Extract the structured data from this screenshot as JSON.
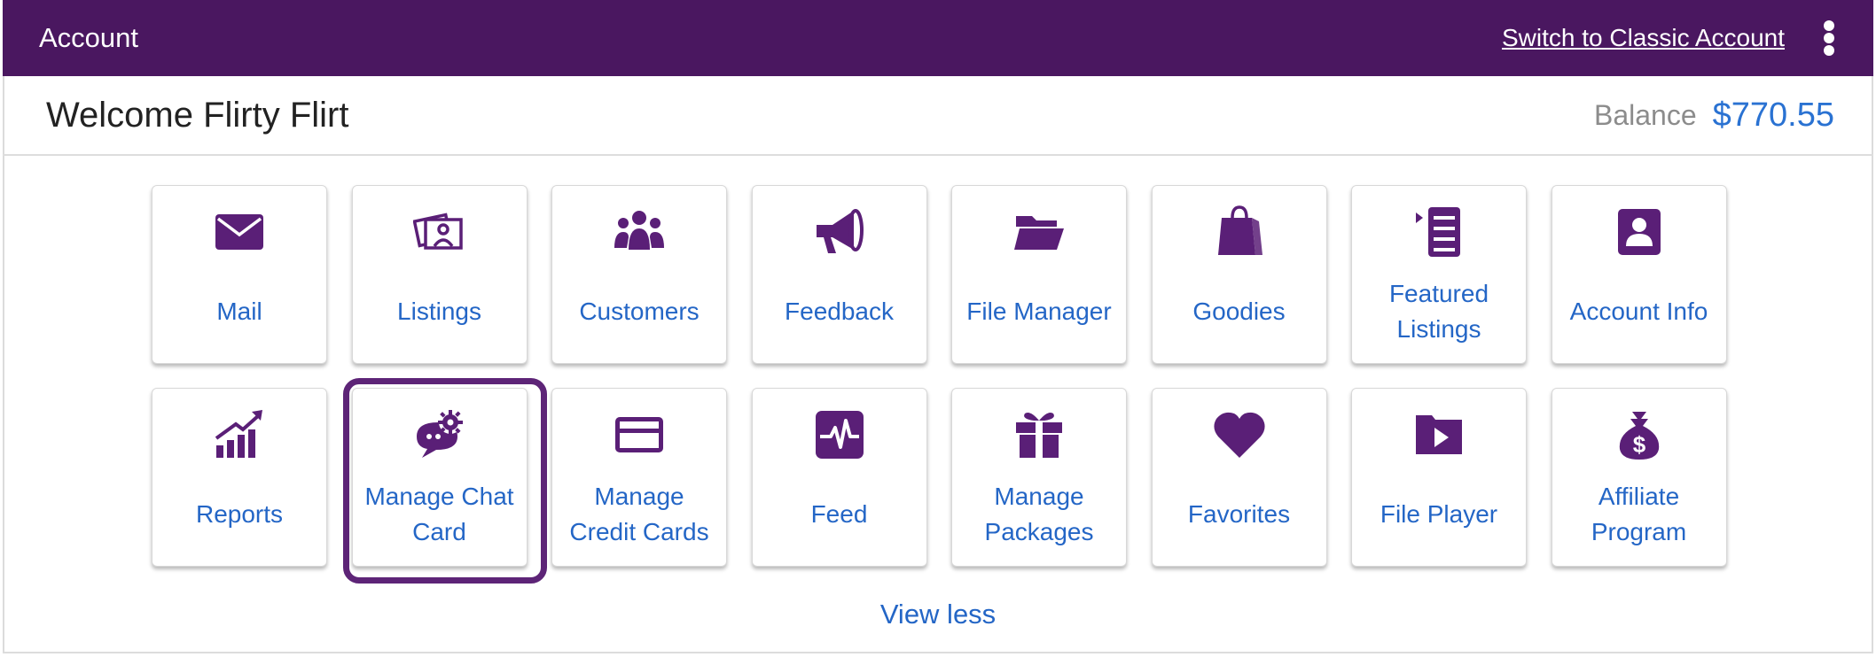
{
  "header": {
    "title": "Account",
    "switch_link": "Switch to Classic Account",
    "menu_icon": "kebab-menu-icon"
  },
  "welcome": {
    "text": "Welcome Flirty Flirt",
    "balance_label": "Balance",
    "balance_value": "$770.55"
  },
  "tiles": [
    {
      "label": "Mail",
      "icon": "mail-icon"
    },
    {
      "label": "Listings",
      "icon": "listings-icon"
    },
    {
      "label": "Customers",
      "icon": "customers-icon"
    },
    {
      "label": "Feedback",
      "icon": "megaphone-icon"
    },
    {
      "label": "File Manager",
      "icon": "folder-icon"
    },
    {
      "label": "Goodies",
      "icon": "shopping-bag-icon"
    },
    {
      "label": "Featured Listings",
      "icon": "featured-list-icon"
    },
    {
      "label": "Account Info",
      "icon": "account-card-icon"
    },
    {
      "label": "Reports",
      "icon": "growth-chart-icon"
    },
    {
      "label": "Manage Chat Card",
      "icon": "chat-gear-icon",
      "selected": true
    },
    {
      "label": "Manage Credit Cards",
      "icon": "credit-card-icon"
    },
    {
      "label": "Feed",
      "icon": "pulse-icon"
    },
    {
      "label": "Manage Packages",
      "icon": "gift-icon"
    },
    {
      "label": "Favorites",
      "icon": "heart-icon"
    },
    {
      "label": "File Player",
      "icon": "video-folder-icon"
    },
    {
      "label": "Affiliate Program",
      "icon": "money-bag-icon"
    }
  ],
  "view_less": "View less",
  "colors": {
    "topbar": "#4a1760",
    "icon": "#5a1f77",
    "link": "#2466c6",
    "balance": "#2a72d2",
    "selected_border": "#5d2477"
  }
}
